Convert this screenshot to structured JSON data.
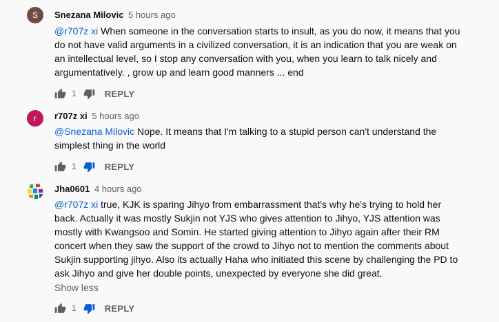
{
  "comments": [
    {
      "author": "Snezana Milovic",
      "time": "5 hours ago",
      "avatar_letter": "S",
      "avatar_color": "#6d4c41",
      "mention": "@r707z xi",
      "lines": [
        " When someone in the conversation starts to insult, as you do now, it means that you",
        "do not have valid arguments in a civilized conversation, it is an indication that you are weak on",
        "an intellectual level, so I stop any conversation with you, when you learn to talk nicely and",
        "argumentatively. , grow up and learn good manners ... end"
      ],
      "likes": "1",
      "reply_label": "REPLY"
    },
    {
      "author": "r707z xi",
      "time": "5 hours ago",
      "avatar_letter": "r",
      "avatar_color": "#c2185b",
      "mention": "@Snezana Milovic",
      "lines": [
        " Nope. It means that I'm talking to a stupid person can't understand the",
        "simplest thing in the world"
      ],
      "likes": "1",
      "reply_label": "REPLY"
    },
    {
      "author": "Jha0601",
      "time": "4 hours ago",
      "avatar_letter": "",
      "avatar_color": "#7cb342",
      "mention": "@r707z xi",
      "lines": [
        " true, KJK is sparing Jihyo from embarrassment that's why he's trying to hold her",
        "back. Actually it was mostly Sukjin not YJS who gives attention to Jihyo, YJS attention was",
        "mostly with Kwangsoo and Somin. He started giving attention to Jihyo again after their RM",
        "concert when they saw the support of the crowd to Jihyo not to mention the comments about",
        "Sukjin supporting jihyo. Also its actually Haha who initiated this scene by challenging the PD to",
        "ask Jihyo and give her double points, unexpected by everyone she did great."
      ],
      "show_less": "Show less",
      "likes": "1",
      "reply_label": "REPLY"
    }
  ]
}
